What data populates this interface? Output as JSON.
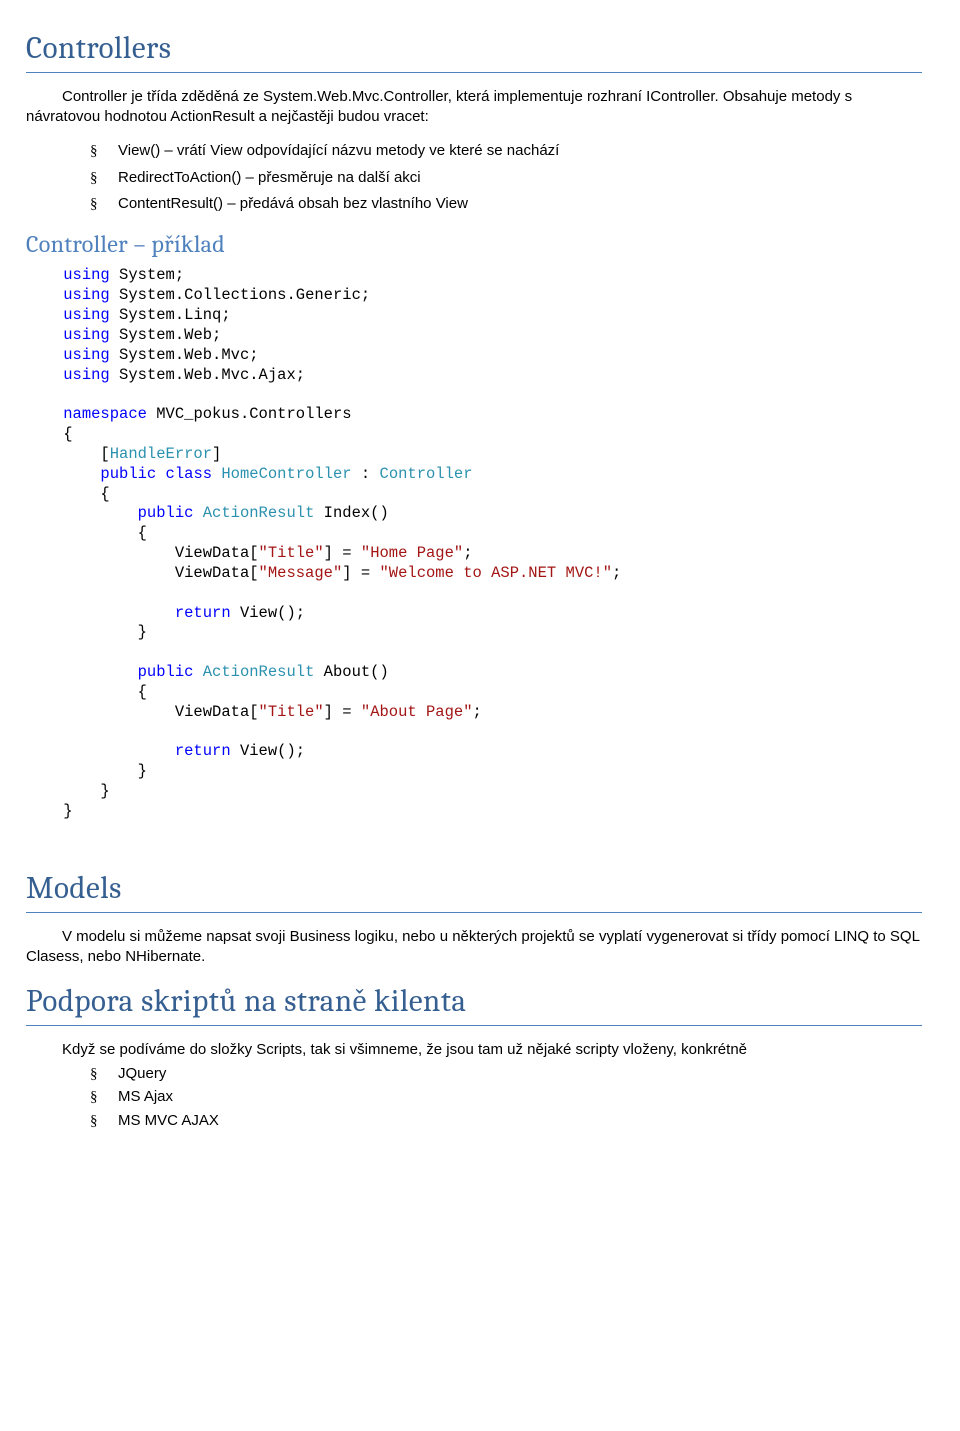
{
  "h1_controllers": "Controllers",
  "p_controllers_intro": "Controller je třída zděděná ze System.Web.Mvc.Controller, která implementuje rozhraní IController. Obsahuje metody s návratovou hodnotou ActionResult a nejčastěji budou vracet:",
  "list_controllers": [
    "View() – vrátí View odpovídající názvu metody ve které se nachází",
    "RedirectToAction() – přesměruje na další akci",
    "ContentResult() – předává obsah bez vlastního View"
  ],
  "h2_example": "Controller – příklad",
  "code": {
    "using": "using",
    "ns1": " System;",
    "ns2": " System.Collections.Generic;",
    "ns3": " System.Linq;",
    "ns4": " System.Web;",
    "ns5": " System.Web.Mvc;",
    "ns6": " System.Web.Mvc.Ajax;",
    "namespace": "namespace",
    "nsname": " MVC_pokus.Controllers",
    "obr": "{",
    "cbr": "}",
    "attr": "HandleError",
    "public": "public",
    "class": "class",
    "homectrl": "HomeController",
    "colon_ctrl": " : ",
    "controller": "Controller",
    "aresult": "ActionResult",
    "idx": " Index()",
    "about": " About()",
    "vd_open": "ViewData[",
    "k_title": "\"Title\"",
    "k_msg": "\"Message\"",
    "vd_close": "] = ",
    "v_home": "\"Home Page\"",
    "v_welcome": "\"Welcome to ASP.NET MVC!\"",
    "v_about": "\"About Page\"",
    "semi": ";",
    "return": "return",
    "viewcall": " View();"
  },
  "h1_models": "Models",
  "p_models": "V modelu si můžeme napsat svoji Business logiku, nebo u některých projektů se vyplatí vygenerovat si třídy pomocí LINQ to SQL Clasess, nebo NHibernate.",
  "h1_podpora": "Podpora skriptů na straně kilenta",
  "p_podpora": "Když se podíváme do složky Scripts, tak si všimneme, že jsou tam už nějaké scripty vloženy, konkrétně",
  "list_podpora": [
    "JQuery",
    "MS Ajax",
    "MS MVC AJAX"
  ]
}
